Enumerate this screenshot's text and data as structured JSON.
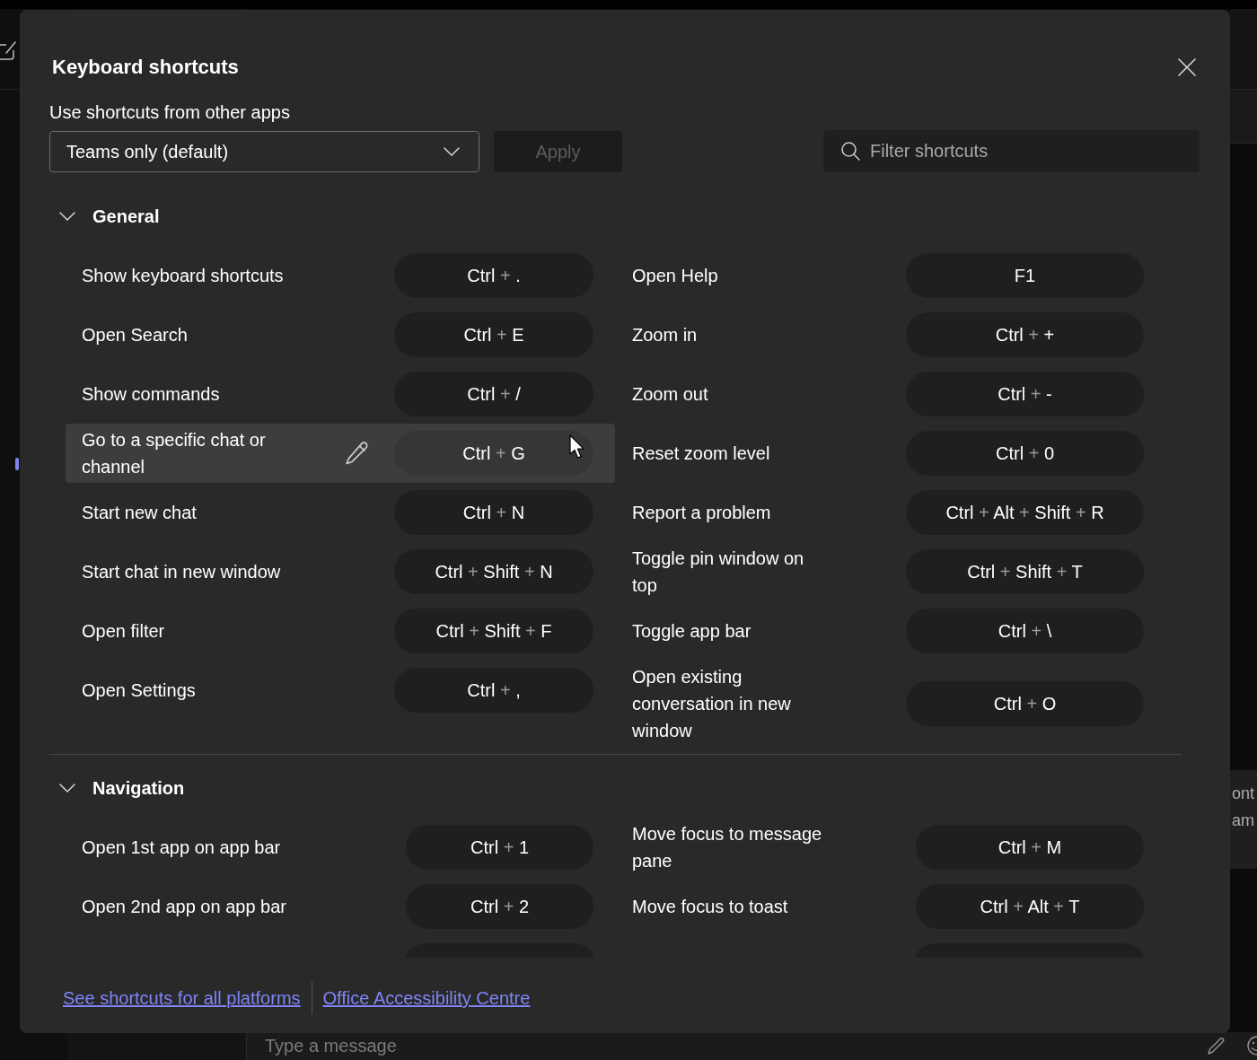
{
  "dialog": {
    "title": "Keyboard shortcuts",
    "shortcut_source": {
      "label": "Use shortcuts from other apps",
      "value": "Teams only (default)"
    },
    "apply_button": {
      "label": "Apply",
      "disabled": true
    },
    "filter": {
      "placeholder": "Filter shortcuts"
    },
    "key_separator": "+",
    "sections": [
      {
        "title": "General",
        "expanded": true,
        "more_rows_below": false,
        "columns": [
          [
            {
              "action": "Show keyboard shortcuts",
              "keys": [
                "Ctrl",
                "."
              ],
              "hovered": false
            },
            {
              "action": "Open Search",
              "keys": [
                "Ctrl",
                "E"
              ],
              "hovered": false
            },
            {
              "action": "Show commands",
              "keys": [
                "Ctrl",
                "/"
              ],
              "hovered": false
            },
            {
              "action": "Go to a specific chat or channel",
              "keys": [
                "Ctrl",
                "G"
              ],
              "hovered": true
            },
            {
              "action": "Start new chat",
              "keys": [
                "Ctrl",
                "N"
              ],
              "hovered": false
            },
            {
              "action": "Start chat in new window",
              "keys": [
                "Ctrl",
                "Shift",
                "N"
              ],
              "hovered": false
            },
            {
              "action": "Open filter",
              "keys": [
                "Ctrl",
                "Shift",
                "F"
              ],
              "hovered": false
            },
            {
              "action": "Open Settings",
              "keys": [
                "Ctrl",
                ","
              ],
              "hovered": false
            }
          ],
          [
            {
              "action": "Open Help",
              "keys": [
                "F1"
              ],
              "hovered": false
            },
            {
              "action": "Zoom in",
              "keys": [
                "Ctrl",
                "+"
              ],
              "hovered": false
            },
            {
              "action": "Zoom out",
              "keys": [
                "Ctrl",
                "-"
              ],
              "hovered": false
            },
            {
              "action": "Reset zoom level",
              "keys": [
                "Ctrl",
                "0"
              ],
              "hovered": false
            },
            {
              "action": "Report a problem",
              "keys": [
                "Ctrl",
                "Alt",
                "Shift",
                "R"
              ],
              "hovered": false
            },
            {
              "action": "Toggle pin window on top",
              "keys": [
                "Ctrl",
                "Shift",
                "T"
              ],
              "hovered": false
            },
            {
              "action": "Toggle app bar",
              "keys": [
                "Ctrl",
                "\\"
              ],
              "hovered": false
            },
            {
              "action": "Open existing conversation in new window",
              "keys": [
                "Ctrl",
                "O"
              ],
              "hovered": false
            }
          ]
        ]
      },
      {
        "title": "Navigation",
        "expanded": true,
        "more_rows_below": true,
        "columns": [
          [
            {
              "action": "Open 1st app on app bar",
              "keys": [
                "Ctrl",
                "1"
              ],
              "hovered": false
            },
            {
              "action": "Open 2nd app on app bar",
              "keys": [
                "Ctrl",
                "2"
              ],
              "hovered": false
            }
          ],
          [
            {
              "action": "Move focus to message pane",
              "keys": [
                "Ctrl",
                "M"
              ],
              "hovered": false
            },
            {
              "action": "Move focus to toast",
              "keys": [
                "Ctrl",
                "Alt",
                "T"
              ],
              "hovered": false
            }
          ]
        ]
      }
    ],
    "footer_links": [
      "See shortcuts for all platforms",
      "Office Accessibility Centre"
    ]
  },
  "background_app": {
    "side_panel_text": [
      "ont",
      "am"
    ],
    "message_box": {
      "placeholder": "Type a message"
    }
  }
}
